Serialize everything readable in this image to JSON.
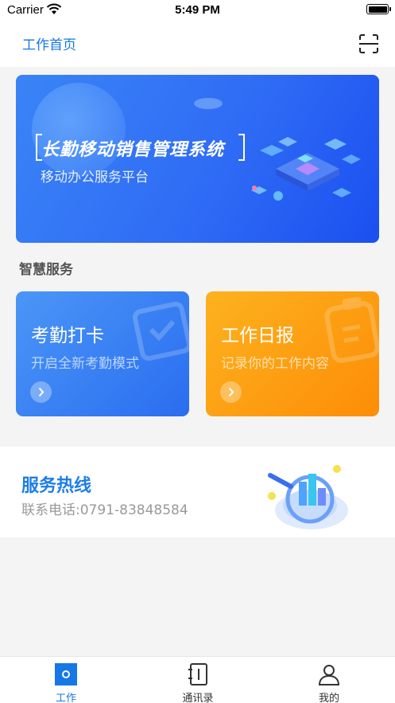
{
  "status_bar": {
    "carrier": "Carrier",
    "time": "5:49 PM",
    "wifi_icon": "wifi-icon",
    "battery_icon": "battery-full-icon"
  },
  "nav": {
    "title": "工作首页",
    "scan_icon": "scan-icon"
  },
  "banner": {
    "title": "长勤移动销售管理系统",
    "subtitle": "移动办公服务平台"
  },
  "section": {
    "title": "智慧服务"
  },
  "cards": [
    {
      "title": "考勤打卡",
      "description": "开启全新考勤模式",
      "icon": "chevron-right-icon",
      "color": "#2f74f3"
    },
    {
      "title": "工作日报",
      "description": "记录你的工作内容",
      "icon": "chevron-right-icon",
      "color": "#fd9a10"
    }
  ],
  "hotline": {
    "title": "服务热线",
    "phone": "联系电话:0791-83848584"
  },
  "tab_bar": {
    "tabs": [
      {
        "label": "工作",
        "icon": "work-icon",
        "active": true
      },
      {
        "label": "通讯录",
        "icon": "contacts-book-icon",
        "active": false
      },
      {
        "label": "我的",
        "icon": "person-icon",
        "active": false
      }
    ]
  },
  "colors": {
    "accent": "#1677e6",
    "background": "#f4f4f4",
    "banner_blue": "#2f6cf5",
    "report_orange": "#fd9a10"
  }
}
